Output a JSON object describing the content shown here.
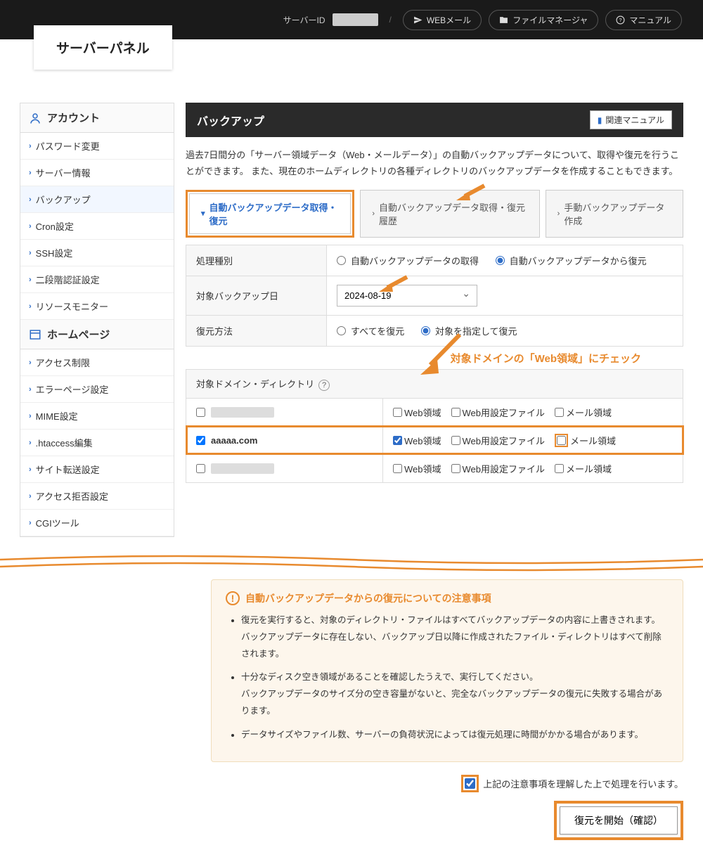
{
  "header": {
    "logo": "サーバーパネル",
    "server_id_label": "サーバーID",
    "buttons": {
      "webmail": "WEBメール",
      "filemanager": "ファイルマネージャ",
      "manual": "マニュアル"
    }
  },
  "sidebar": {
    "section_account": "アカウント",
    "account_items": [
      "パスワード変更",
      "サーバー情報",
      "バックアップ",
      "Cron設定",
      "SSH設定",
      "二段階認証設定",
      "リソースモニター"
    ],
    "active_account_index": 2,
    "section_homepage": "ホームページ",
    "homepage_items": [
      "アクセス制限",
      "エラーページ設定",
      "MIME設定",
      ".htaccess編集",
      "サイト転送設定",
      "アクセス拒否設定",
      "CGIツール"
    ]
  },
  "main": {
    "title": "バックアップ",
    "manual_btn": "関連マニュアル",
    "description": "過去7日間分の「サーバー領域データ（Web・メールデータ）」の自動バックアップデータについて、取得や復元を行うことができます。 また、現在のホームディレクトリの各種ディレクトリのバックアップデータを作成することもできます。",
    "tabs": [
      "自動バックアップデータ取得・復元",
      "自動バックアップデータ取得・復元履歴",
      "手動バックアップデータ作成"
    ],
    "form": {
      "row1_label": "処理種別",
      "row1_opt1": "自動バックアップデータの取得",
      "row1_opt2": "自動バックアップデータから復元",
      "row2_label": "対象バックアップ日",
      "row2_value": "2024-08-19",
      "row3_label": "復元方法",
      "row3_opt1": "すべてを復元",
      "row3_opt2": "対象を指定して復元"
    },
    "annotation": "対象ドメインの「Web領域」にチェック",
    "domain_table": {
      "header": "対象ドメイン・ディレクトリ",
      "col_web": "Web領域",
      "col_webconf": "Web用設定ファイル",
      "col_mail": "メール領域",
      "rows": [
        {
          "name": "",
          "redacted": true,
          "sel": false,
          "web": false,
          "webconf": false,
          "mail": false
        },
        {
          "name": "aaaaa.com",
          "redacted": false,
          "sel": true,
          "web": true,
          "webconf": false,
          "mail": false,
          "highlight": true
        },
        {
          "name": "",
          "redacted": true,
          "sel": false,
          "web": false,
          "webconf": false,
          "mail": false
        }
      ]
    },
    "warning": {
      "title": "自動バックアップデータからの復元についての注意事項",
      "items": [
        "復元を実行すると、対象のディレクトリ・ファイルはすべてバックアップデータの内容に上書きされます。\nバックアップデータに存在しない、バックアップ日以降に作成されたファイル・ディレクトリはすべて削除されます。",
        "十分なディスク空き領域があることを確認したうえで、実行してください。\nバックアップデータのサイズ分の空き容量がないと、完全なバックアップデータの復元に失敗する場合があります。",
        "データサイズやファイル数、サーバーの負荷状況によっては復元処理に時間がかかる場合があります。"
      ]
    },
    "confirm_label": "上記の注意事項を理解した上で処理を行います。",
    "submit_label": "復元を開始（確認）"
  }
}
